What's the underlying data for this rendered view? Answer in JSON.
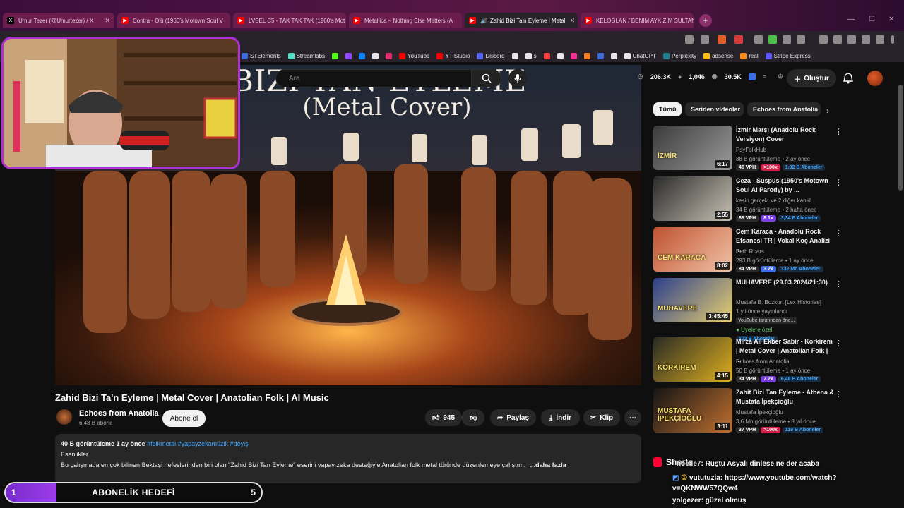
{
  "browser": {
    "tabs": [
      {
        "label": "Umur Tezer (@Umurtezer) / X",
        "icon": "x-logo-icon",
        "color": "#000000"
      },
      {
        "label": "Contra - Ölü (1960's Motown Soul V",
        "icon": "youtube-icon",
        "color": "#ff0000"
      },
      {
        "label": "LVBEL C5 - TAK TAK TAK (1960's Mot",
        "icon": "youtube-icon",
        "color": "#ff0000"
      },
      {
        "label": "Metallica – Nothing Else Matters (A",
        "icon": "youtube-icon",
        "color": "#ff0000"
      },
      {
        "label": "Zahid Bizi Ta'n Eyleme | Metal",
        "icon": "youtube-icon",
        "color": "#ff0000",
        "active": true
      },
      {
        "label": "KELOĞLAN / BENİM AYKIZIM SULTAN",
        "icon": "youtube-icon",
        "color": "#ff0000"
      }
    ],
    "bookmarks": [
      {
        "label": "STElements",
        "color": "#3a6ad8"
      },
      {
        "label": "Streamlabs",
        "color": "#53e0c2"
      },
      {
        "label": "",
        "color": "#53fc18"
      },
      {
        "label": "",
        "color": "#9146ff"
      },
      {
        "label": "",
        "color": "#1185fe"
      },
      {
        "label": "",
        "color": "#e6e6e6"
      },
      {
        "label": "",
        "color": "#e1306c"
      },
      {
        "label": "YouTube",
        "color": "#ff0000"
      },
      {
        "label": "YT Studio",
        "color": "#ff0000"
      },
      {
        "label": "Discord",
        "color": "#5865f2"
      },
      {
        "label": "",
        "color": "#e6e6e6"
      },
      {
        "label": "s",
        "color": "#e6e6e6"
      },
      {
        "label": "",
        "color": "#ff3a3a"
      },
      {
        "label": "",
        "color": "#e6e6e6"
      },
      {
        "label": "",
        "color": "#ff2d95"
      },
      {
        "label": "",
        "color": "#f48024"
      },
      {
        "label": "",
        "color": "#3a6ad8"
      },
      {
        "label": "",
        "color": "#e6e6e6"
      },
      {
        "label": "ChatGPT",
        "color": "#e6e6e6"
      },
      {
        "label": "Perplexity",
        "color": "#20808d"
      },
      {
        "label": "adsense",
        "color": "#fbbc04"
      },
      {
        "label": "real",
        "color": "#ff8c1a"
      },
      {
        "label": "Stripe Express",
        "color": "#635bff"
      }
    ]
  },
  "masthead": {
    "search_placeholder": "Ara",
    "stats": [
      "206.3K",
      "1,046",
      "30.5K"
    ],
    "create_label": "Oluştur"
  },
  "video": {
    "overlay_top": "BIZI TAN EYLEME",
    "overlay_sub": "(Metal Cover)",
    "title": "Zahid Bizi Ta'n Eyleme | Metal Cover | Anatolian Folk | AI Music",
    "channel": "Echoes from Anatolia",
    "subscribers": "6,48 B abone",
    "subscribe_label": "Abone ol",
    "likes": "945",
    "share_label": "Paylaş",
    "download_label": "İndir",
    "clip_label": "Klip",
    "description": {
      "meta": "40 B görüntüleme  1 ay önce",
      "tags": "#folkmetal #yapayzekamüzik #deyiş",
      "line1": "Esenlikler.",
      "line2": "Bu çalışmada en çok bilinen Bektaşi nefeslerinden biri olan \"Zahid Bizi Tan Eyleme\" eserini yapay zeka desteğiyle Anatolian folk metal türünde düzenlemeye çalıştım.",
      "more": "...daha fazla"
    }
  },
  "goal": {
    "start": "1",
    "label": "ABONELİK HEDEFİ",
    "end": "5",
    "progress": 0.2
  },
  "sidebar": {
    "chips": [
      {
        "label": "Tümü",
        "active": true
      },
      {
        "label": "Seriden videolar",
        "active": false
      },
      {
        "label": "Echoes from Anatolia",
        "active": false
      }
    ],
    "recommendations": [
      {
        "title": "İzmir Marşı (Anadolu Rock Versiyon) Cover",
        "channel": "PsyFolkHub",
        "meta": "88 B görüntüleme • 2 ay önce",
        "duration": "6:17",
        "vph": "46 VPH",
        "mult": ">100x",
        "mult_color": "#d11f4a",
        "subs": "1,92 B Aboneler",
        "thumb": [
          "#3b3b3b",
          "#9a9a9a"
        ]
      },
      {
        "title": "Ceza - Suspus (1950's Motown Soul AI Parody) by ...",
        "channel": "kesin gerçek. ve 2 diğer kanal",
        "meta": "34 B görüntüleme • 2 hafta önce",
        "duration": "2:55",
        "vph": "68 VPH",
        "mult": "8.1x",
        "mult_color": "#7a3fe0",
        "subs": "3,34 B Aboneler",
        "thumb": [
          "#2a2a2a",
          "#c9c2b5"
        ]
      },
      {
        "title": "Cem Karaca - Anadolu Rock Efsanesi TR | Vokal Koç Analizi ...",
        "channel": "Beth Roars",
        "meta": "293 B görüntüleme • 1 ay önce",
        "duration": "8:02",
        "vph": "84 VPH",
        "mult": "3.2x",
        "mult_color": "#3e6fe0",
        "subs": "132 Mn Aboneler",
        "thumb": [
          "#c0512f",
          "#f0c4a8"
        ]
      },
      {
        "title": "MUHAVERE (29.03.2024/21:30)",
        "channel": "Mustafa B. Bozkurt [Lex Historiae]",
        "meta": "1 yıl önce yayınlandı",
        "duration": "3:45:45",
        "yt_label": "YouTube tarafından öne...",
        "members": "Üyelere özel",
        "subs": "102 B Aboneler",
        "thumb": [
          "#2b3f8c",
          "#e8d070"
        ]
      },
      {
        "title": "Mirza Ali Ekber Sabir - Korkirem | Metal Cover | Anatolian Folk | ...",
        "channel": "Echoes from Anatolia",
        "meta": "50 B görüntüleme • 1 ay önce",
        "duration": "4:15",
        "vph": "34 VPH",
        "mult": "7.2x",
        "mult_color": "#7a3fe0",
        "subs": "6,48 B Aboneler",
        "thumb": [
          "#2a2a24",
          "#e0b020"
        ]
      },
      {
        "title": "Zahit Bizi Tan Eyleme - Athena & Mustafa İpekçioğlu",
        "channel": "Mustafa İpekçioğlu",
        "meta": "3,6 Mn görüntüleme • 8 yıl önce",
        "duration": "3:11",
        "vph": "37 VPH",
        "mult": ">100x",
        "mult_color": "#d11f4a",
        "subs": "119 B Aboneler",
        "thumb": [
          "#141414",
          "#c07030"
        ]
      }
    ],
    "thumb_texts": {
      "t1": "İZMİR",
      "t3": "CEM KARACA",
      "t4": "MUHAVERE",
      "t5": "KORKİREM",
      "t6": "MUSTAFA İPEKÇİOĞLU"
    }
  },
  "chat": {
    "shorts_label": "Shorts",
    "msg1_user": "noelle7",
    "msg1_text": ": Rüştü Asyalı dinlese ne der acaba",
    "msg2_user": "vututuzia",
    "msg2_text": ": https://www.youtube.com/watch?v=QKNWW57QQw4",
    "msg3_user": "yolgezer",
    "msg3_text": ": güzel olmuş"
  }
}
